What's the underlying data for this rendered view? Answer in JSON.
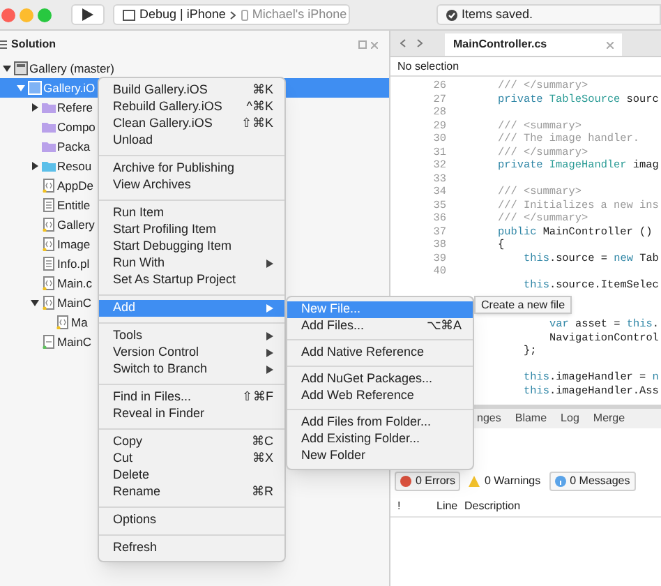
{
  "toolbar": {
    "scheme": "Debug | iPhone",
    "device": "Michael's iPhone",
    "status": "Items saved."
  },
  "solution_pane": {
    "title": "Solution",
    "tree": [
      {
        "label": "Gallery (master)",
        "kind": "solution",
        "expanded": true,
        "selected": false,
        "children": [
          {
            "label": "Gallery.iO",
            "kind": "project",
            "expanded": true,
            "selected": true,
            "children": [
              {
                "label": "Refere",
                "kind": "folder",
                "expanded": false,
                "selected": false
              },
              {
                "label": "Compo",
                "kind": "folder",
                "selected": false
              },
              {
                "label": "Packa",
                "kind": "folder",
                "selected": false
              },
              {
                "label": "Resou",
                "kind": "resource-folder",
                "expanded": false,
                "selected": false
              },
              {
                "label": "AppDe",
                "kind": "code-file",
                "selected": false
              },
              {
                "label": "Entitle",
                "kind": "plist-file",
                "selected": false
              },
              {
                "label": "Gallery",
                "kind": "code-file",
                "selected": false
              },
              {
                "label": "Image",
                "kind": "code-file",
                "selected": false
              },
              {
                "label": "Info.pl",
                "kind": "plist-file",
                "selected": false
              },
              {
                "label": "Main.c",
                "kind": "code-file",
                "selected": false
              },
              {
                "label": "MainC",
                "kind": "code-file",
                "expanded": true,
                "selected": false,
                "children": [
                  {
                    "label": "Ma",
                    "kind": "code-file",
                    "selected": false
                  }
                ]
              },
              {
                "label": "MainC",
                "kind": "storyboard-file",
                "selected": false
              }
            ]
          }
        ]
      }
    ]
  },
  "editor": {
    "tabs": [
      {
        "label": "MainController.cs",
        "selected": true
      }
    ],
    "breadcrumb": "No selection",
    "lines": [
      {
        "number": "26",
        "tokens": [
          {
            "text": "/// </summary>",
            "kind": "comment"
          }
        ]
      },
      {
        "number": "27",
        "tokens": [
          {
            "text": "private",
            "kind": "keyword"
          },
          {
            "text": "TableSource",
            "kind": "type"
          },
          {
            "text": "sourc",
            "kind": "plain"
          }
        ]
      },
      {
        "number": "28"
      },
      {
        "number": "29",
        "tokens": [
          {
            "text": "/// <summary>",
            "kind": "comment"
          }
        ]
      },
      {
        "number": "30",
        "tokens": [
          {
            "text": "/// The image handler.",
            "kind": "comment"
          }
        ]
      },
      {
        "number": "31",
        "tokens": [
          {
            "text": "/// </summary>",
            "kind": "comment"
          }
        ]
      },
      {
        "number": "32",
        "tokens": [
          {
            "text": "private",
            "kind": "keyword"
          },
          {
            "text": "ImageHandler",
            "kind": "type"
          },
          {
            "text": "imag",
            "kind": "plain"
          }
        ]
      },
      {
        "number": "33"
      },
      {
        "number": "34",
        "tokens": [
          {
            "text": "/// <summary>",
            "kind": "comment"
          }
        ]
      },
      {
        "number": "35",
        "tokens": [
          {
            "text": "/// Initializes a new ins",
            "kind": "comment"
          }
        ]
      },
      {
        "number": "36",
        "tokens": [
          {
            "text": "/// </summary>",
            "kind": "comment"
          }
        ]
      },
      {
        "number": "37",
        "tokens": [
          {
            "text": "public",
            "kind": "keyword"
          },
          {
            "text": "MainController ()",
            "kind": "plain"
          }
        ]
      },
      {
        "number": "38",
        "tokens": [
          {
            "text": "{",
            "kind": "plain"
          }
        ]
      },
      {
        "number": "39",
        "kind": "inner",
        "tokens": [
          {
            "text": "this",
            "kind": "keyword"
          },
          {
            "text": ".source =",
            "kind": "plain"
          },
          {
            "text": "new",
            "kind": "keyword"
          },
          {
            "text": "Tab",
            "kind": "plain"
          }
        ]
      },
      {
        "number": "40"
      },
      {
        "kind": "inner",
        "tokens": [
          {
            "text": "this",
            "kind": "keyword"
          },
          {
            "text": ".source.ItemSelec",
            "kind": "plain"
          }
        ]
      },
      {
        "kind": "blank"
      },
      {
        "kind": "blank"
      },
      {
        "kind": "deep",
        "tokens": [
          {
            "text": "var",
            "kind": "keyword"
          },
          {
            "text": "asset =",
            "kind": "plain"
          },
          {
            "text": "this",
            "kind": "keyword"
          },
          {
            "text": ".",
            "kind": "joined"
          }
        ]
      },
      {
        "kind": "deep",
        "tokens": [
          {
            "text": "NavigationControl",
            "kind": "plain"
          }
        ]
      },
      {
        "kind": "inner",
        "tokens": [
          {
            "text": "};",
            "kind": "plain"
          }
        ]
      },
      {
        "kind": "blank"
      },
      {
        "kind": "inner",
        "tokens": [
          {
            "text": "this",
            "kind": "keyword"
          },
          {
            "text": ".imageHandler =",
            "kind": "plain"
          },
          {
            "text": "n",
            "kind": "keyword"
          }
        ]
      },
      {
        "kind": "inner",
        "tokens": [
          {
            "text": "this",
            "kind": "keyword"
          },
          {
            "text": ".imageHandler.Ass",
            "kind": "joined"
          }
        ]
      }
    ]
  },
  "bottom_panel": {
    "tabs": [
      "nges",
      "Blame",
      "Log",
      "Merge"
    ],
    "filters": [
      {
        "label": "0 Errors",
        "kind": "error"
      },
      {
        "label": "0 Warnings",
        "kind": "warning"
      },
      {
        "label": "0 Messages",
        "kind": "message"
      }
    ],
    "columns": [
      "!",
      "Line",
      "Description"
    ]
  },
  "context_menu": {
    "groups": [
      [
        {
          "label": "Build Gallery.iOS",
          "shortcut": "⌘K",
          "selected": false
        },
        {
          "label": "Rebuild Gallery.iOS",
          "shortcut": "^⌘K",
          "selected": false
        },
        {
          "label": "Clean Gallery.iOS",
          "shortcut": "⇧⌘K",
          "selected": false
        },
        {
          "label": "Unload",
          "selected": false
        }
      ],
      [
        {
          "label": "Archive for Publishing",
          "selected": false
        },
        {
          "label": "View Archives",
          "selected": false
        }
      ],
      [
        {
          "label": "Run Item",
          "selected": false
        },
        {
          "label": "Start Profiling Item",
          "selected": false
        },
        {
          "label": "Start Debugging Item",
          "selected": false
        },
        {
          "label": "Run With",
          "submenu": true,
          "selected": false
        },
        {
          "label": "Set As Startup Project",
          "selected": false
        }
      ],
      [
        {
          "label": "Add",
          "submenu": true,
          "selected": true
        }
      ],
      [
        {
          "label": "Tools",
          "submenu": true,
          "selected": false
        },
        {
          "label": "Version Control",
          "submenu": true,
          "selected": false
        },
        {
          "label": "Switch to Branch",
          "submenu": true,
          "selected": false
        }
      ],
      [
        {
          "label": "Find in Files...",
          "shortcut": "⇧⌘F",
          "selected": false
        },
        {
          "label": "Reveal in Finder",
          "selected": false
        }
      ],
      [
        {
          "label": "Copy",
          "shortcut": "⌘C",
          "selected": false
        },
        {
          "label": "Cut",
          "shortcut": "⌘X",
          "selected": false
        },
        {
          "label": "Delete",
          "selected": false
        },
        {
          "label": "Rename",
          "shortcut": "⌘R",
          "selected": false
        }
      ],
      [
        {
          "label": "Options",
          "selected": false
        }
      ],
      [
        {
          "label": "Refresh",
          "selected": false
        }
      ]
    ]
  },
  "submenu": {
    "groups": [
      [
        {
          "label": "New File...",
          "selected": true
        },
        {
          "label": "Add Files...",
          "shortcut": "⌥⌘A",
          "selected": false
        }
      ],
      [
        {
          "label": "Add Native Reference",
          "selected": false
        }
      ],
      [
        {
          "label": "Add NuGet Packages...",
          "selected": false
        },
        {
          "label": "Add Web Reference",
          "selected": false
        }
      ],
      [
        {
          "label": "Add Files from Folder...",
          "selected": false
        },
        {
          "label": "Add Existing Folder...",
          "selected": false
        },
        {
          "label": "New Folder",
          "selected": false
        }
      ]
    ]
  },
  "tooltip": "Create a new file"
}
